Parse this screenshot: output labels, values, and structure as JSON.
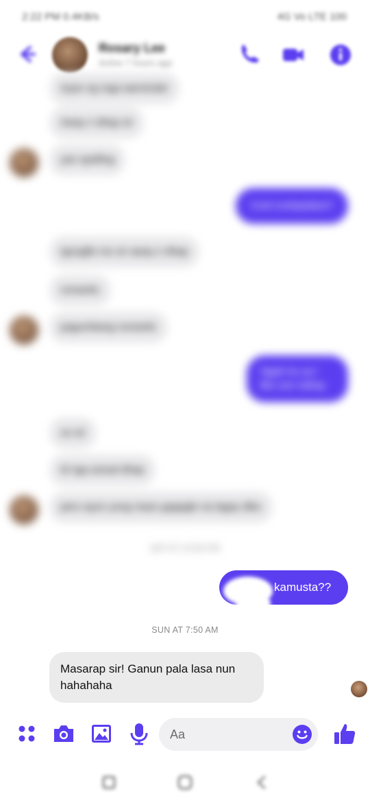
{
  "status_bar": {
    "left": "2:22 PM  0.4KB/s",
    "right": "4G  Vo LTE  100"
  },
  "header": {
    "name": "Rosary Lee",
    "status": "Active 7 hours ago"
  },
  "blurred_messages": [
    {
      "dir": "in",
      "text": "Ayan ng mga iaeminder"
    },
    {
      "dir": "in",
      "text": "Away n dhap sir"
    },
    {
      "dir": "in",
      "text": "yan spelling"
    },
    {
      "dir": "out",
      "text": "Cool contepdass?"
    },
    {
      "dir": "in",
      "text": "Igooglle mo sir away n dhap"
    },
    {
      "dir": "in",
      "text": "romantic"
    },
    {
      "dir": "in",
      "text": "pagumbang romantic"
    },
    {
      "dir": "out",
      "text": "Ngek ho sa / Bio sun nahay"
    },
    {
      "dir": "in",
      "text": "oo sir"
    },
    {
      "dir": "in",
      "text": "di nga actual dhap"
    },
    {
      "dir": "in",
      "text": "pero ayun yong mass gagagle na lagay diko"
    }
  ],
  "blurred_time": "SAT AT 10:59 PM",
  "last_sent": "kamusta??",
  "time_separator": "SUN AT 7:50 AM",
  "last_received": "Masarap sir! Ganun pala lasa nun hahahaha",
  "composer": {
    "placeholder": "Aa"
  },
  "colors": {
    "accent": "#5b3ef0",
    "incoming_bubble": "#ebebec"
  }
}
